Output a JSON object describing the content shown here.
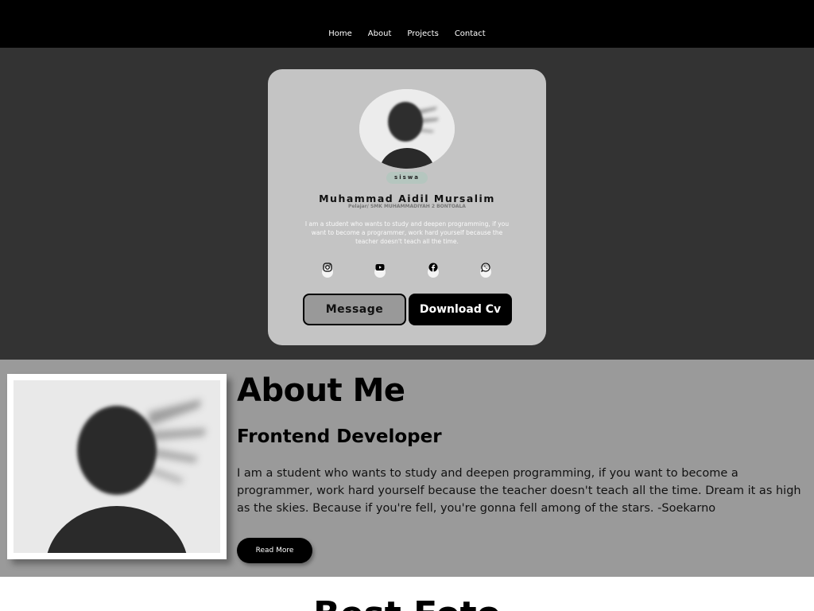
{
  "nav": {
    "items": [
      "Home",
      "About",
      "Projects",
      "Contact"
    ]
  },
  "profile": {
    "badge": "siswa",
    "name": "Muhammad Aidil Mursalim",
    "subtitle": "Pelajar/ SMK MUHAMMADIYAH 2 BONTOALA",
    "description": "I am a student who wants to study and deepen programming, if you want to become a programmer, work hard yourself because the teacher doesn't teach all the time.",
    "socials": [
      "instagram-icon",
      "youtube-icon",
      "facebook-icon",
      "whatsapp-icon"
    ],
    "message_button": "Message",
    "download_button": "Download Cv"
  },
  "about": {
    "title": "About Me",
    "role": "Frontend Developer",
    "text": "I am a student who wants to study and deepen programming, if you want to become a programmer, work hard yourself because the teacher doesn't teach all the time. Dream it as high as the skies. Because if you're fell, you're gonna fell among of the stars. -Soekarno",
    "read_more": "Read More"
  },
  "best": {
    "title": "Best Foto"
  },
  "colors": {
    "nav_bg": "#000000",
    "hero_bg": "#333333",
    "card_bg": "#c4c4c4",
    "about_bg": "#9a9a9a",
    "badge_bg": "#b5c6bf"
  }
}
